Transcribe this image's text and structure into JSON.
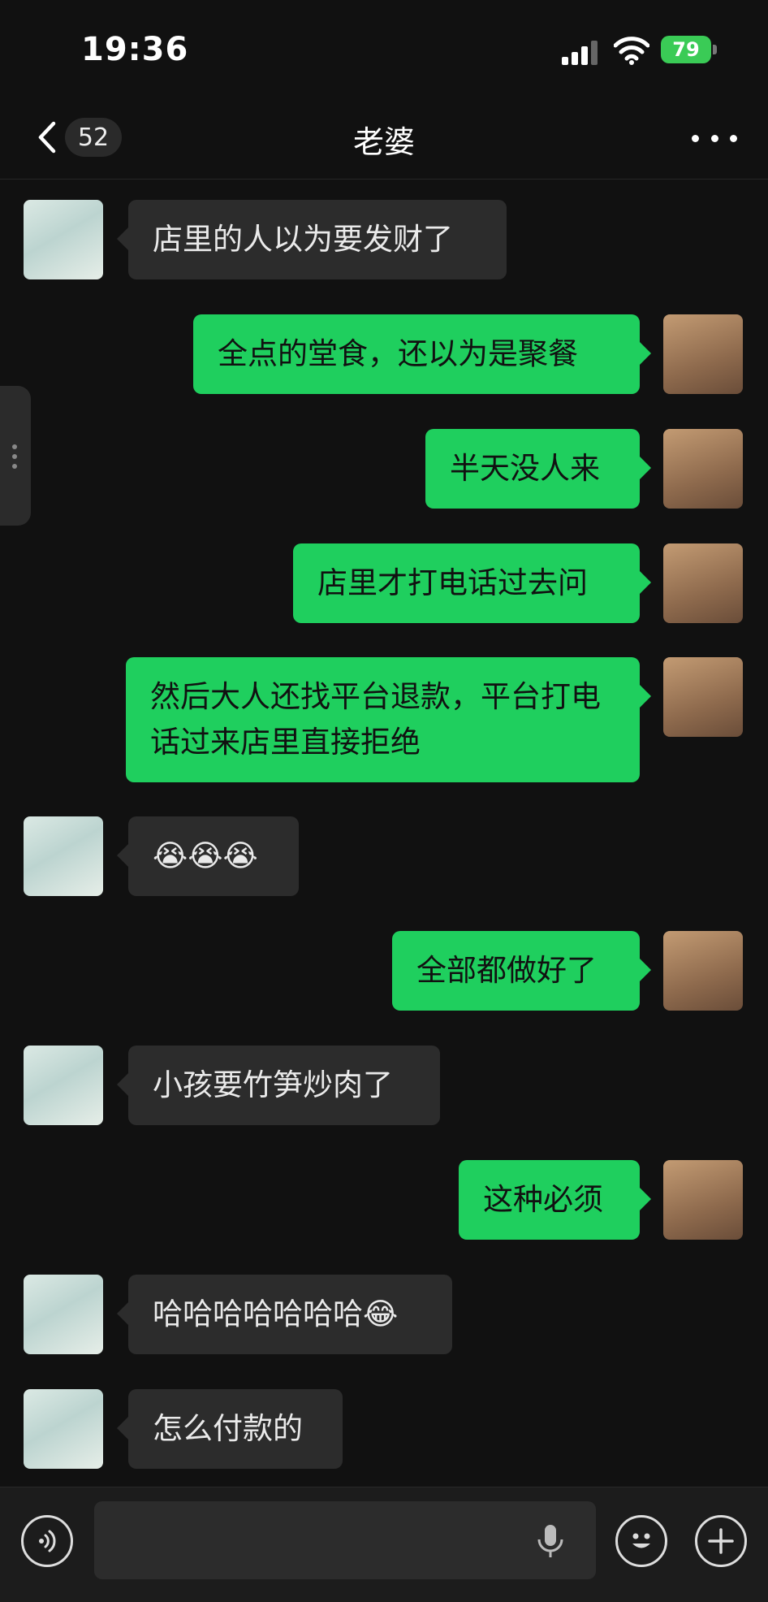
{
  "status_bar": {
    "time": "19:36",
    "battery": "79"
  },
  "header": {
    "unread_count": "52",
    "title": "老婆"
  },
  "messages": [
    {
      "side": "left",
      "text": "店里的人以为要发财了"
    },
    {
      "side": "right",
      "text": "全点的堂食，还以为是聚餐"
    },
    {
      "side": "right",
      "text": "半天没人来"
    },
    {
      "side": "right",
      "text": "店里才打电话过去问"
    },
    {
      "side": "right",
      "text": "然后大人还找平台退款，平台打电话过来店里直接拒绝"
    },
    {
      "side": "left",
      "text": "😭😭😭"
    },
    {
      "side": "right",
      "text": "全部都做好了"
    },
    {
      "side": "left",
      "text": "小孩要竹笋炒肉了"
    },
    {
      "side": "right",
      "text": "这种必须"
    },
    {
      "side": "left",
      "text": "哈哈哈哈哈哈哈😂"
    },
    {
      "side": "left",
      "text": "怎么付款的"
    }
  ],
  "input_bar": {
    "placeholder": ""
  },
  "icons": {
    "back": "chevron-left-icon",
    "more": "more-dots-icon",
    "voice": "voice-icon",
    "mic": "microphone-icon",
    "emoji": "emoji-icon",
    "add": "plus-icon"
  },
  "colors": {
    "sent_bubble": "#1fcf5e",
    "received_bubble": "#2c2c2c",
    "background": "#111111"
  }
}
